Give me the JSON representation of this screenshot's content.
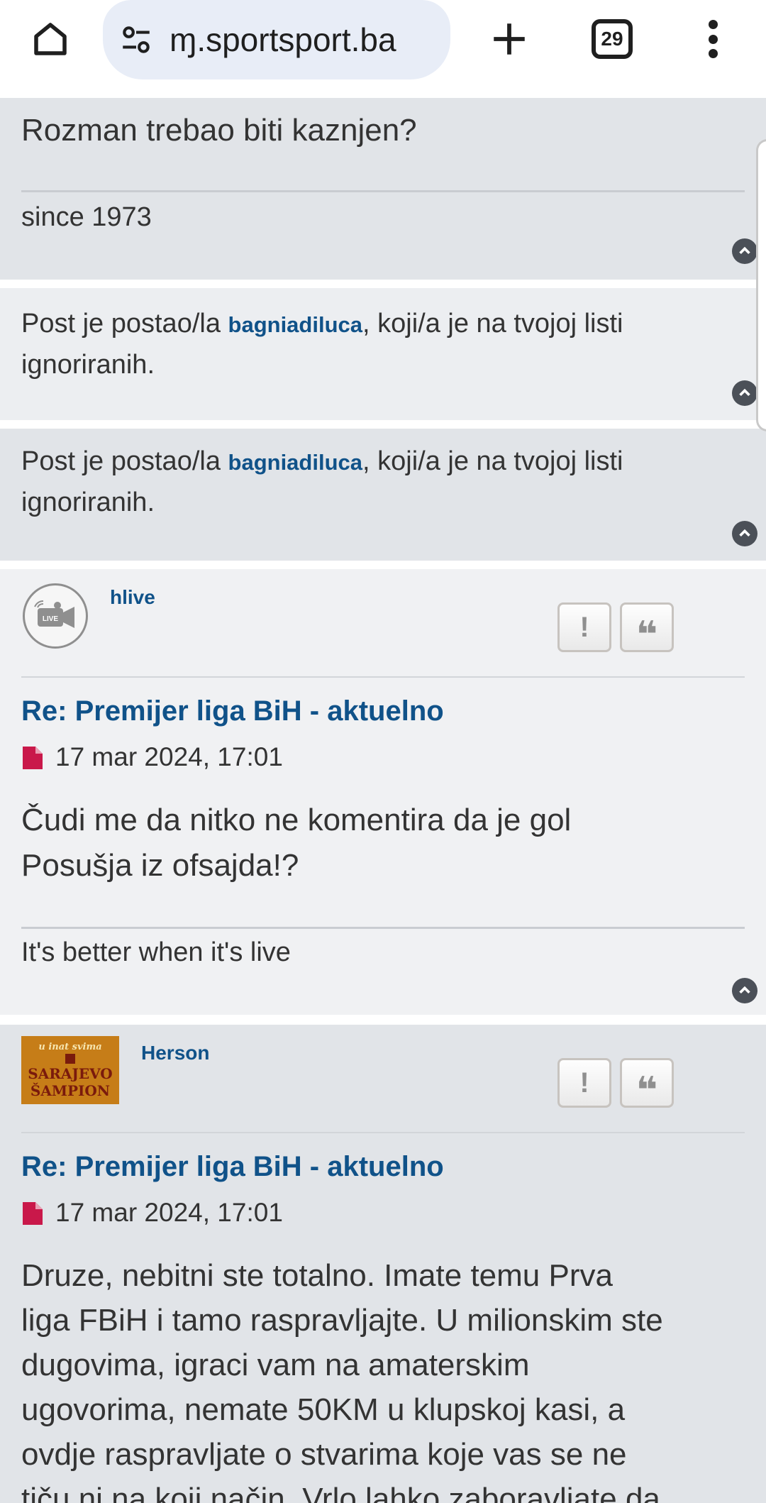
{
  "browser": {
    "url": "ɱ.sportsport.ba",
    "tab_count": "29"
  },
  "posts": [
    {
      "body_line1": "Rozman trebao biti kaznjen?",
      "signature": "since 1973"
    },
    {
      "ignored_prefix": "Post je postao/la ",
      "ignored_user": "bagniadiluca",
      "ignored_suffix": ", koji/a je na tvojoj listi",
      "ignored_line2": "ignoriranih."
    },
    {
      "ignored_prefix": "Post je postao/la ",
      "ignored_user": "bagniadiluca",
      "ignored_suffix": ", koji/a je na tvojoj listi",
      "ignored_line2": "ignoriranih."
    },
    {
      "author": "hlive",
      "avatar_text": "LIVE",
      "report_label": "!",
      "quote_label": "❝",
      "title": "Re: Premijer liga BiH - aktuelno",
      "date": "17 mar 2024, 17:01",
      "body_line1": "Čudi me da nitko ne komentira da je gol",
      "body_line2": "Posušja iz ofsajda!?",
      "signature": "It's better when it's live"
    },
    {
      "author": "Herson",
      "avatar_line1": "u inat svima",
      "avatar_line2": "SARAJEVO",
      "avatar_line3": "ŠAMPION",
      "report_label": "!",
      "quote_label": "❝",
      "title": "Re: Premijer liga BiH - aktuelno",
      "date": "17 mar 2024, 17:01",
      "body_lines": [
        "Druze, nebitni ste totalno. Imate temu Prva",
        "liga FBiH i tamo raspravljajte. U milionskim ste",
        "dugovima, igraci vam na amaterskim",
        "ugovorima, nemate 50KM u klupskoj kasi, a",
        "ovdje raspravljate o stvarima koje vas se ne",
        "tiču ni na koji način. Vrlo lahko zaboravljate da"
      ]
    }
  ]
}
